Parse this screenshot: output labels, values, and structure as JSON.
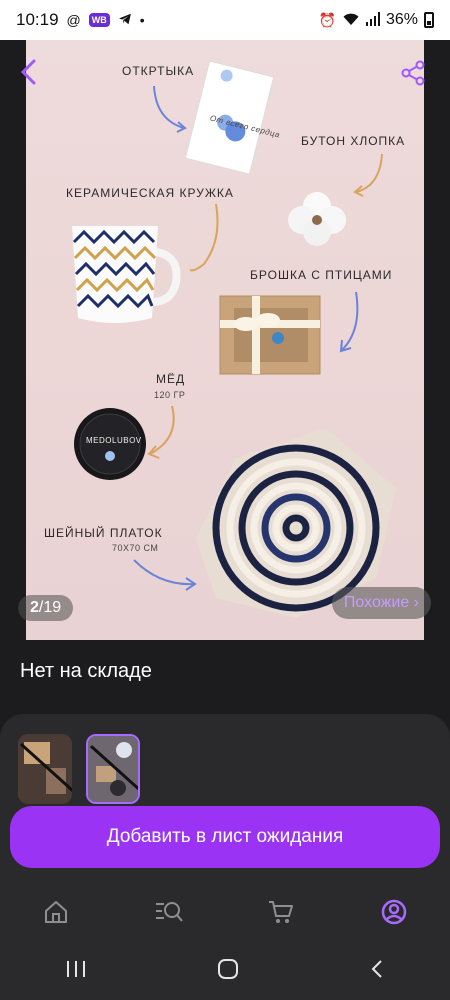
{
  "status": {
    "time": "10:19",
    "badge": "WB",
    "dot": "•",
    "battery": "36%",
    "icons": [
      "at-icon",
      "wb-badge",
      "telegram-icon",
      "dot-icon",
      "alarm-icon",
      "wifi-icon",
      "signal-icon",
      "battery-icon"
    ]
  },
  "product_image": {
    "annotations": {
      "card": "ОТКРТЫКА",
      "cotton": "БУТОН ХЛОПКА",
      "mug": "КЕРАМИЧЕСКАЯ КРУЖКА",
      "brooch": "БРОШКА С ПТИЦАМИ",
      "honey": "МЁД",
      "honey_weight": "120 ГР",
      "scarf": "ШЕЙНЫЙ ПЛАТОК",
      "scarf_size": "70Х70 СМ"
    },
    "honey_label": "MEDOLUBOV",
    "card_text": "От всего сердца",
    "counter_current": "2",
    "counter_separator": "/",
    "counter_total": "19",
    "similar_label": "Похожие ›"
  },
  "stock": {
    "label": "Нет на складе"
  },
  "cta": {
    "label": "Добавить в лист ожидания"
  },
  "bottom_nav": [
    "home-icon",
    "catalog-search-icon",
    "cart-icon",
    "profile-icon"
  ],
  "system_nav": [
    "recent-apps-icon",
    "home-circle-icon",
    "back-icon"
  ],
  "colors": {
    "accent": "#9b33f5",
    "accent_text": "#c59cff",
    "background": "#1c1c1e",
    "card": "#2a2a2c"
  }
}
